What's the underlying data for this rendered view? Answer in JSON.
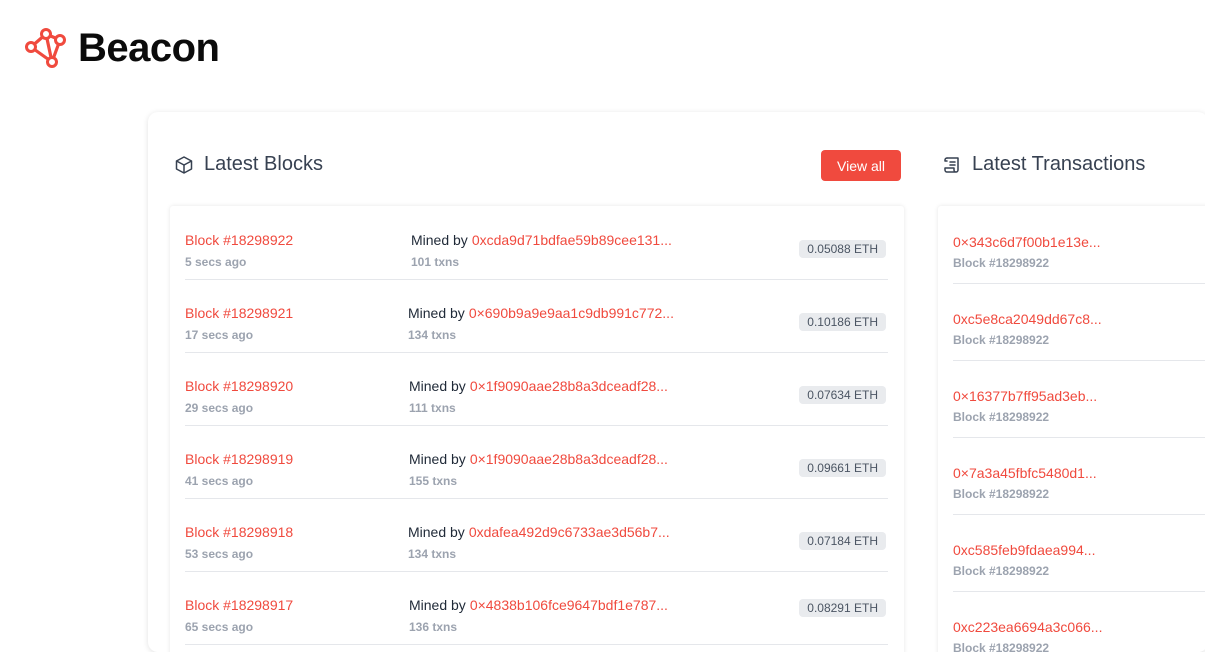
{
  "brand": {
    "name": "Beacon",
    "icon": "beacon-logo-icon",
    "color": "#f04a3e"
  },
  "blocks_section": {
    "title": "Latest Blocks",
    "icon": "cube-icon",
    "view_all_label": "View all",
    "mined_by_label": "Mined by",
    "rows": [
      {
        "block": "Block #18298922",
        "time": "5 secs ago",
        "miner": "0xcda9d71bdfae59b89cee131...",
        "txns": "101 txns",
        "reward": "0.05088 ETH"
      },
      {
        "block": "Block #18298921",
        "time": "17 secs ago",
        "miner": "0×690b9a9e9aa1c9db991c772...",
        "txns": "134 txns",
        "reward": "0.10186 ETH"
      },
      {
        "block": "Block #18298920",
        "time": "29 secs ago",
        "miner": "0×1f9090aae28b8a3dceadf28...",
        "txns": "111 txns",
        "reward": "0.07634 ETH"
      },
      {
        "block": "Block #18298919",
        "time": "41 secs ago",
        "miner": "0×1f9090aae28b8a3dceadf28...",
        "txns": "155 txns",
        "reward": "0.09661 ETH"
      },
      {
        "block": "Block #18298918",
        "time": "53 secs ago",
        "miner": "0xdafea492d9c6733ae3d56b7...",
        "txns": "134 txns",
        "reward": "0.07184 ETH"
      },
      {
        "block": "Block #18298917",
        "time": "65 secs ago",
        "miner": "0×4838b106fce9647bdf1e787...",
        "txns": "136 txns",
        "reward": "0.08291 ETH"
      }
    ]
  },
  "tx_section": {
    "title": "Latest Transactions",
    "icon": "scroll-icon",
    "rows": [
      {
        "hash": "0×343c6d7f00b1e13e...",
        "block": "Block #18298922"
      },
      {
        "hash": "0xc5e8ca2049dd67c8...",
        "block": "Block #18298922"
      },
      {
        "hash": "0×16377b7ff95ad3eb...",
        "block": "Block #18298922"
      },
      {
        "hash": "0×7a3a45fbfc5480d1...",
        "block": "Block #18298922"
      },
      {
        "hash": "0xc585feb9fdaea994...",
        "block": "Block #18298922"
      },
      {
        "hash": "0xc223ea6694a3c066...",
        "block": "Block #18298922"
      }
    ]
  }
}
